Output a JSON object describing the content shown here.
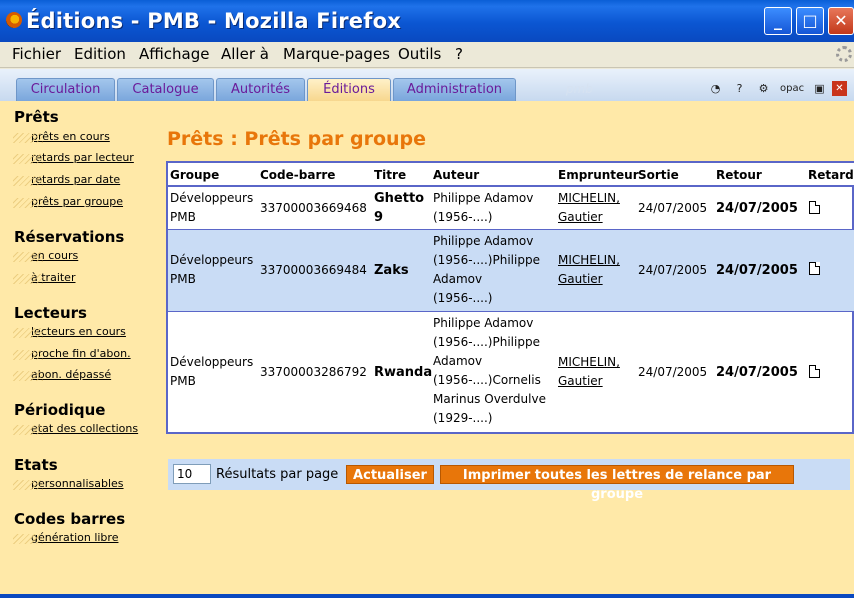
{
  "window": {
    "title": "Éditions - PMB - Mozilla Firefox"
  },
  "menubar": [
    "Fichier",
    "Edition",
    "Affichage",
    "Aller à",
    "Marque-pages",
    "Outils",
    "?"
  ],
  "tabs": [
    "Circulation",
    "Catalogue",
    "Autorités",
    "Éditions",
    "Administration"
  ],
  "tab_logo": "pmb",
  "tab_icons": {
    "opac": "opac"
  },
  "sidebar": [
    {
      "title": "Prêts",
      "links": [
        "prêts en cours",
        "retards par lecteur",
        "retards par date",
        "prêts par groupe"
      ]
    },
    {
      "title": "Réservations",
      "links": [
        "en cours",
        "à traiter"
      ]
    },
    {
      "title": "Lecteurs",
      "links": [
        "lecteurs en cours",
        "proche fin d'abon.",
        "abon. dépassé"
      ]
    },
    {
      "title": "Périodique",
      "links": [
        "etat des collections"
      ]
    },
    {
      "title": "Etats",
      "links": [
        "personnalisables"
      ]
    },
    {
      "title": "Codes barres",
      "links": [
        "génération libre"
      ]
    }
  ],
  "page_title": "Prêts : Prêts par groupe",
  "table": {
    "headers": [
      "Groupe",
      "Code-barre",
      "Titre",
      "Auteur",
      "Emprunteur",
      "Sortie",
      "Retour",
      "Retard"
    ],
    "rows": [
      {
        "groupe": [
          "Développeurs",
          "PMB"
        ],
        "code": "33700003669468",
        "titre": [
          "Ghetto",
          "9"
        ],
        "auteur": [
          "Philippe Adamov",
          "(1956-....)"
        ],
        "emprunteur": [
          "MICHELIN,",
          "Gautier"
        ],
        "sortie": "24/07/2005",
        "retour": "24/07/2005"
      },
      {
        "groupe": [
          "Développeurs",
          "PMB"
        ],
        "code": "33700003669484",
        "titre": [
          "Zaks"
        ],
        "auteur": [
          "Philippe Adamov",
          "(1956-....)Philippe",
          "Adamov",
          "(1956-....)"
        ],
        "emprunteur": [
          "MICHELIN,",
          "Gautier"
        ],
        "sortie": "24/07/2005",
        "retour": "24/07/2005"
      },
      {
        "groupe": [
          "Développeurs",
          "PMB"
        ],
        "code": "33700003286792",
        "titre": [
          "Rwanda"
        ],
        "auteur": [
          "Philippe Adamov",
          "(1956-....)Philippe",
          "Adamov",
          "(1956-....)Cornelis",
          "Marinus Overdulve",
          "(1929-....)"
        ],
        "emprunteur": [
          "MICHELIN,",
          "Gautier"
        ],
        "sortie": "24/07/2005",
        "retour": "24/07/2005"
      }
    ]
  },
  "pagination": {
    "per_page_value": "10",
    "per_page_label": "Résultats par page"
  },
  "buttons": {
    "refresh": "Actualiser",
    "print_all": "Imprimer toutes les lettres de relance par groupe"
  }
}
